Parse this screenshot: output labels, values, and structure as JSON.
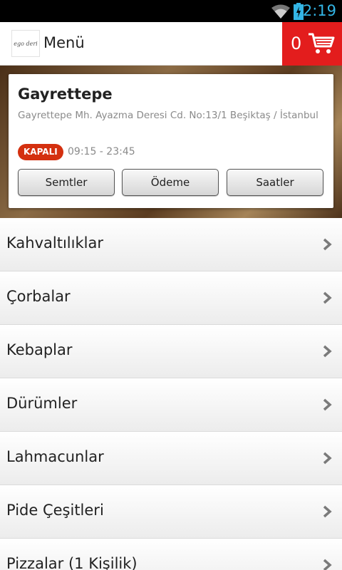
{
  "status_bar": {
    "time": "2:19",
    "icons": [
      "wifi-icon",
      "battery-charging-icon"
    ]
  },
  "app_bar": {
    "logo_text": "ego deri",
    "title": "Menü",
    "cart_count": "0",
    "cart_icon": "shopping-cart-icon"
  },
  "colors": {
    "cart_bg": "#e31d1d",
    "badge_bg": "#d4300f",
    "status_time": "#33b5e5"
  },
  "restaurant": {
    "name": "Gayrettepe",
    "address": "Gayrettepe Mh. Ayazma Deresi Cd. No:13/1 Beşiktaş / İstanbul",
    "status_badge": "KAPALI",
    "hours": "09:15 - 23:45",
    "buttons": [
      "Semtler",
      "Ödeme",
      "Saatler"
    ]
  },
  "menu": {
    "items": [
      "Kahvaltılıklar",
      "Çorbalar",
      "Kebaplar",
      "Dürümler",
      "Lahmacunlar",
      "Pide Çeşitleri",
      "Pizzalar (1 Kişilik)"
    ],
    "item_icon": "chevron-right-icon"
  }
}
